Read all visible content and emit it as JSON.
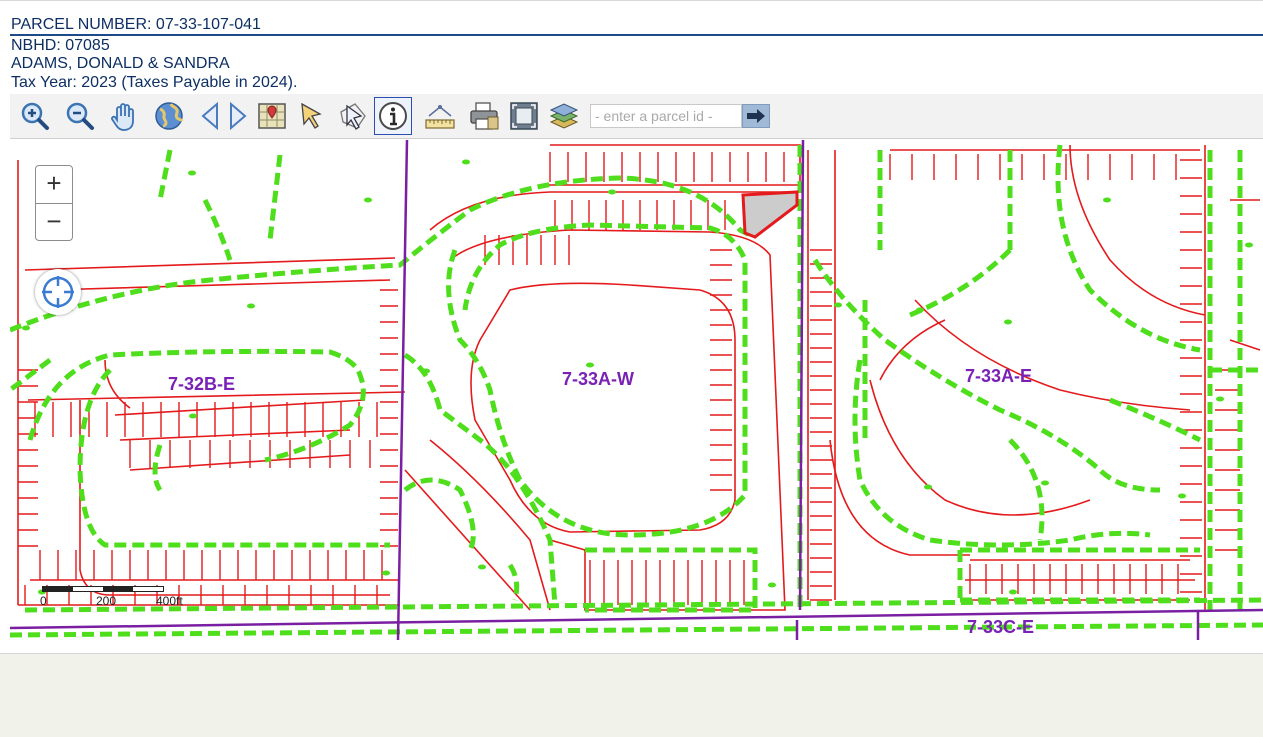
{
  "header": {
    "parcel_number": "PARCEL NUMBER: 07-33-107-041",
    "nbhd": "NBHD: 07085",
    "owner": "ADAMS, DONALD & SANDRA",
    "tax_year": "Tax Year: 2023 (Taxes Payable in 2024)."
  },
  "toolbar": {
    "tools": [
      {
        "name": "zoom-in-tool",
        "icon": "magnifier-plus-icon"
      },
      {
        "name": "zoom-out-tool",
        "icon": "magnifier-minus-icon"
      },
      {
        "name": "pan-tool",
        "icon": "hand-icon"
      },
      {
        "name": "full-extent-tool",
        "icon": "globe-icon"
      },
      {
        "name": "previous-extent-tool",
        "icon": "triangle-left-icon"
      },
      {
        "name": "next-extent-tool",
        "icon": "triangle-right-icon"
      },
      {
        "name": "select-map-tool",
        "icon": "map-pin-icon"
      },
      {
        "name": "select-tool",
        "icon": "arrow-select-icon"
      },
      {
        "name": "select-polygon-tool",
        "icon": "arrow-polygon-icon"
      },
      {
        "name": "identify-tool",
        "icon": "info-icon"
      },
      {
        "name": "measure-tool",
        "icon": "ruler-icon"
      },
      {
        "name": "print-tool",
        "icon": "printer-icon"
      },
      {
        "name": "fullscreen-tool",
        "icon": "fullscreen-icon"
      },
      {
        "name": "layers-tool",
        "icon": "layers-icon"
      }
    ],
    "active_tool": "identify-tool",
    "search_placeholder": "- enter a parcel id -",
    "search_value": ""
  },
  "map": {
    "zoom_in_label": "+",
    "zoom_out_label": "−",
    "labels": {
      "nbhd_1": "7-32B-E",
      "nbhd_2": "7-33A-W",
      "nbhd_3": "7-33A-E",
      "nbhd_4": "7-33C-E"
    },
    "scale": {
      "zero": "0",
      "mid": "200",
      "end": "400ft"
    },
    "colors": {
      "parcel_line": "#e41a1c",
      "road_line": "#4ede1c",
      "boundary_line": "#7a1fa2",
      "label": "#7a22b5",
      "selected_fill": "#cccccc"
    }
  }
}
